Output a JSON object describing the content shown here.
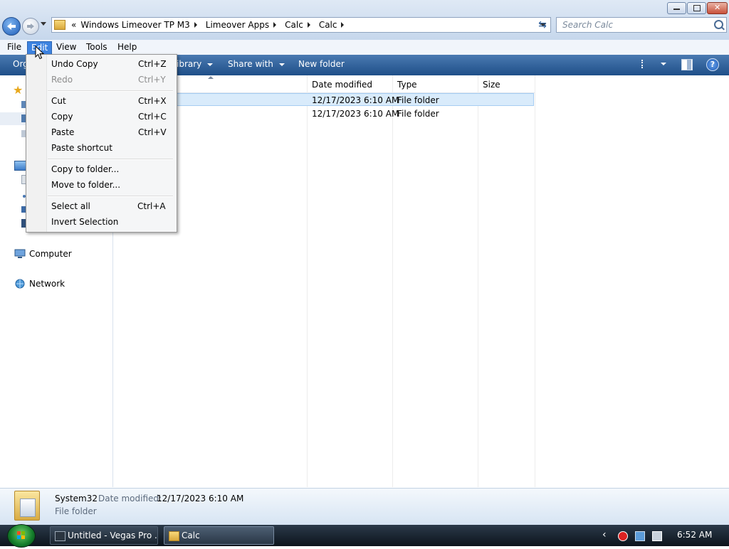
{
  "address": {
    "overflow": "«",
    "crumbs": [
      "Windows Limeover TP M3",
      "Limeover Apps",
      "Calc",
      "Calc"
    ]
  },
  "search": {
    "placeholder": "Search Calc"
  },
  "menubar": [
    "File",
    "Edit",
    "View",
    "Tools",
    "Help"
  ],
  "commandbar": {
    "organize": "Org",
    "library": "ibrary",
    "share": "Share with",
    "newfolder": "New folder"
  },
  "edit_menu": {
    "items": [
      {
        "label": "Undo Copy",
        "shortcut": "Ctrl+Z",
        "enabled": true
      },
      {
        "label": "Redo",
        "shortcut": "Ctrl+Y",
        "enabled": false
      },
      {
        "label": "Cut",
        "shortcut": "Ctrl+X",
        "enabled": true
      },
      {
        "label": "Copy",
        "shortcut": "Ctrl+C",
        "enabled": true
      },
      {
        "label": "Paste",
        "shortcut": "Ctrl+V",
        "enabled": true
      },
      {
        "label": "Paste shortcut",
        "shortcut": "",
        "enabled": true
      },
      {
        "label": "Copy to folder...",
        "shortcut": "",
        "enabled": true
      },
      {
        "label": "Move to folder...",
        "shortcut": "",
        "enabled": true
      },
      {
        "label": "Select all",
        "shortcut": "Ctrl+A",
        "enabled": true
      },
      {
        "label": "Invert Selection",
        "shortcut": "",
        "enabled": true
      }
    ]
  },
  "navpane": {
    "computer": "Computer",
    "network": "Network"
  },
  "columns": [
    "Date modified",
    "Type",
    "Size"
  ],
  "files": [
    {
      "date": "12/17/2023 6:10 AM",
      "type": "File folder",
      "size": ""
    },
    {
      "date": "12/17/2023 6:10 AM",
      "type": "File folder",
      "size": ""
    }
  ],
  "details": {
    "name": "System32",
    "date_label": "Date modified:",
    "date_value": "12/17/2023 6:10 AM",
    "type": "File folder"
  },
  "taskbar": {
    "tasks": [
      "Untitled - Vegas Pro ...",
      "Calc"
    ],
    "clock": "6:52 AM"
  },
  "colors": {
    "accent": "#3d83e0",
    "commandbar": "#2c5d97",
    "selection": "#d9ebfb"
  }
}
